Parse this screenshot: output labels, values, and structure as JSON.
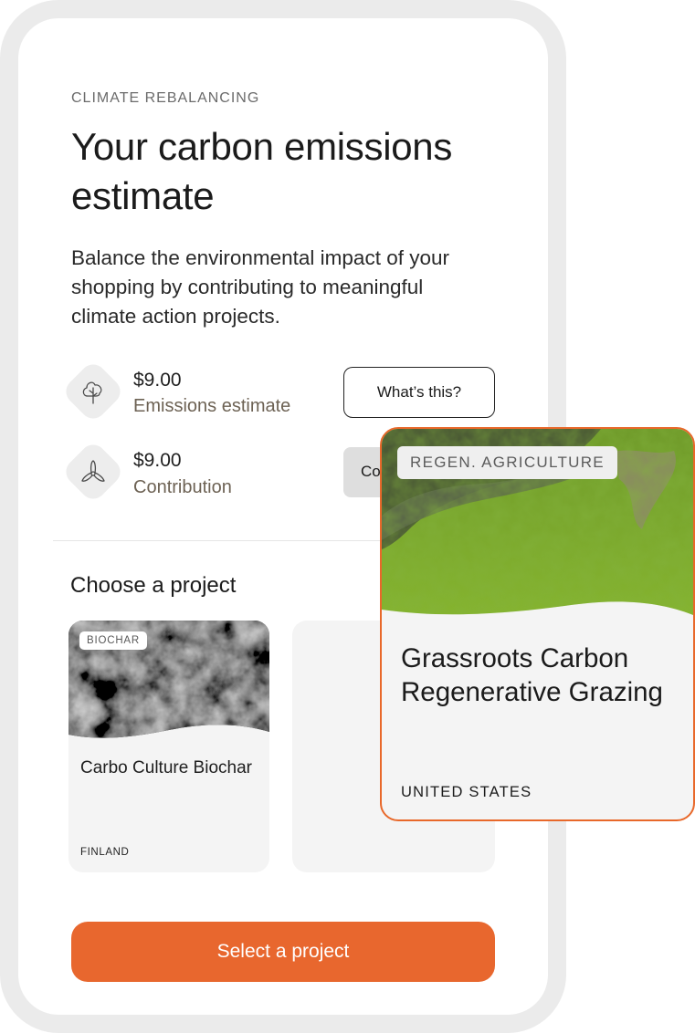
{
  "header": {
    "eyebrow": "CLIMATE REBALANCING",
    "title": "Your carbon emissions estimate",
    "description": "Balance the environmental impact of your shopping by contributing to meaningful climate action projects."
  },
  "summary": {
    "emissions": {
      "amount": "$9.00",
      "label": "Emissions estimate",
      "icon": "tree-icon"
    },
    "contribution": {
      "amount": "$9.00",
      "label": "Contribution",
      "icon": "propeller-icon"
    },
    "whats_this_label": "What’s this?",
    "partial_button_label": "Co"
  },
  "projects": {
    "heading": "Choose a project",
    "cards": [
      {
        "tag": "BIOCHAR",
        "title": "Carbo Culture Biochar",
        "country": "FINLAND"
      }
    ],
    "featured": {
      "tag": "REGEN. AGRICULTURE",
      "title": "Grassroots Carbon Regenerative Grazing",
      "country": "UNITED STATES"
    }
  },
  "cta": {
    "label": "Select a project"
  },
  "colors": {
    "accent": "#e8672e",
    "featured_border": "#e8682a",
    "muted_brown": "#6d6254"
  }
}
